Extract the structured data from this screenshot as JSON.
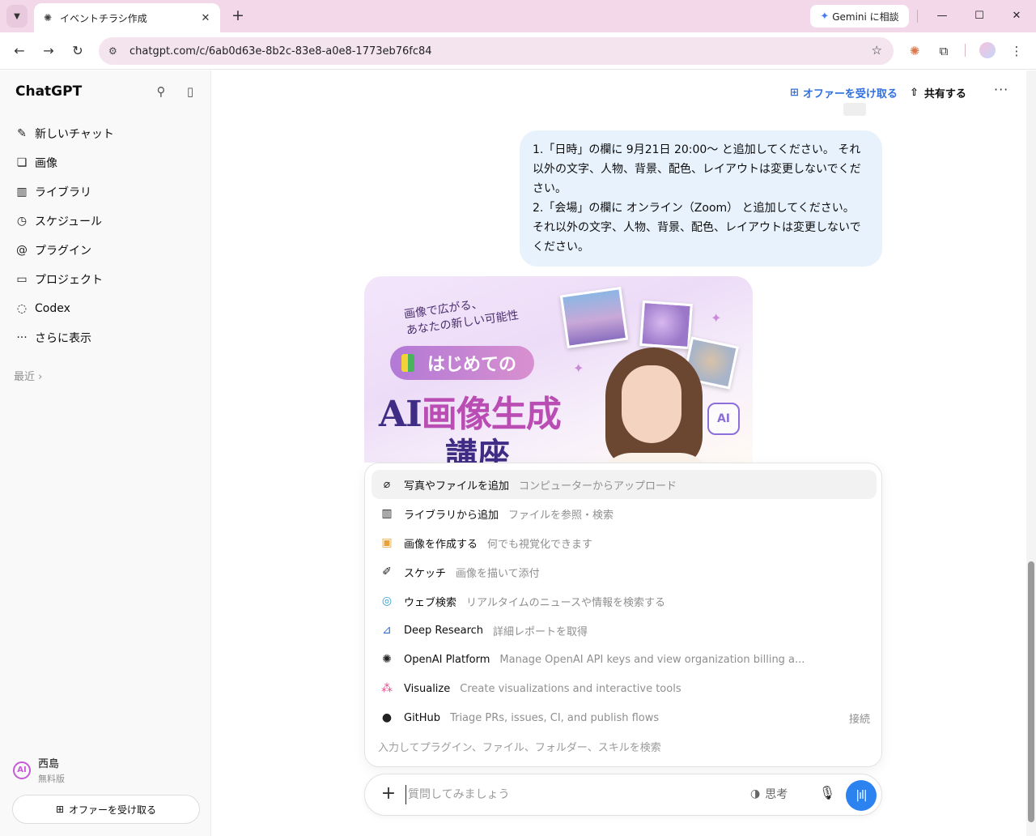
{
  "browser": {
    "tab_title": "イベントチラシ作成",
    "url": "chatgpt.com/c/6ab0d63e-8b2c-83e8-a0e8-1773eb76fc84",
    "gemini_label": "Gemini に相談"
  },
  "sidebar": {
    "brand": "ChatGPT",
    "items": [
      {
        "label": "新しいチャット",
        "icon": "edit-icon"
      },
      {
        "label": "画像",
        "icon": "image-icon"
      },
      {
        "label": "ライブラリ",
        "icon": "library-icon"
      },
      {
        "label": "スケジュール",
        "icon": "clock-icon"
      },
      {
        "label": "プラグイン",
        "icon": "at-icon"
      },
      {
        "label": "プロジェクト",
        "icon": "folder-icon"
      },
      {
        "label": "Codex",
        "icon": "codex-icon"
      },
      {
        "label": "さらに表示",
        "icon": "more-dots-icon"
      }
    ],
    "recent_label": "最近",
    "user": {
      "avatar": "AI",
      "name": "西島",
      "plan": "無料版"
    },
    "offer_label": "オファーを受け取る"
  },
  "header": {
    "offer_label": "オファーを受け取る",
    "share_label": "共有する"
  },
  "conversation": {
    "user_message": [
      "1.「日時」の欄に 9月21日 20:00〜 と追加してください。 それ以外の文字、人物、背景、配色、レイアウトは変更しないでください。",
      "2.「会場」の欄に オンライン（Zoom） と追加してください。 それ以外の文字、人物、背景、配色、レイアウトは変更しないでください。"
    ],
    "image": {
      "tagline_1": "画像で広がる、",
      "tagline_2": "あなたの新しい可能性",
      "pill": "はじめての",
      "headline_ai": "AI",
      "headline_rest": "画像生成",
      "sub": "講座",
      "badge": "AI"
    }
  },
  "menu": {
    "items": [
      {
        "label": "写真やファイルを追加",
        "desc": "コンピューターからアップロード",
        "icon": "paperclip-icon",
        "highlighted": true
      },
      {
        "label": "ライブラリから追加",
        "desc": "ファイルを参照・検索",
        "icon": "library-icon"
      },
      {
        "label": "画像を作成する",
        "desc": "何でも視覚化できます",
        "icon": "image-create-icon"
      },
      {
        "label": "スケッチ",
        "desc": "画像を描いて添付",
        "icon": "sketch-icon"
      },
      {
        "label": "ウェブ検索",
        "desc": "リアルタイムのニュースや情報を検索する",
        "icon": "globe-icon"
      },
      {
        "label": "Deep Research",
        "desc": "詳細レポートを取得",
        "icon": "telescope-icon"
      },
      {
        "label": "OpenAI Platform",
        "desc": "Manage OpenAI API keys and view organization billing a...",
        "icon": "openai-icon"
      },
      {
        "label": "Visualize",
        "desc": "Create visualizations and interactive tools",
        "icon": "visualize-icon"
      },
      {
        "label": "GitHub",
        "desc": "Triage PRs, issues, CI, and publish flows",
        "icon": "github-icon",
        "right": "接続"
      }
    ],
    "search_placeholder": "入力してプラグイン、ファイル、フォルダー、スキルを検索"
  },
  "composer": {
    "placeholder": "質問してみましょう",
    "think_label": "思考"
  },
  "colors": {
    "accent_blue": "#2c83f0",
    "tabstrip": "#f3d8ea",
    "user_bubble": "#e8f2fd"
  }
}
